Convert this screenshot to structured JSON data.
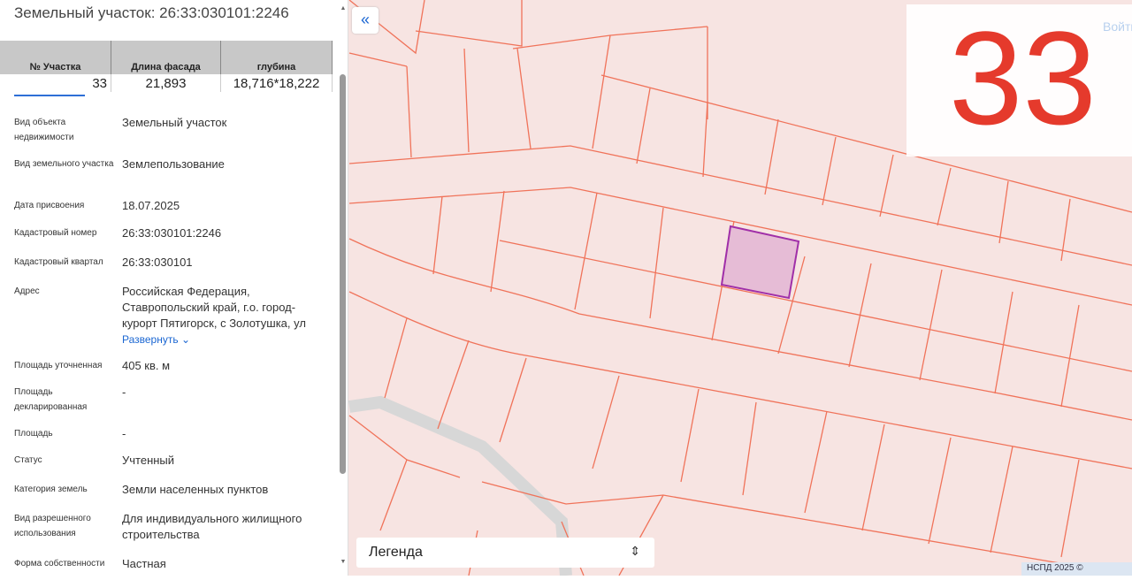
{
  "panel": {
    "title": "Земельный участок: 26:33:030101:2246",
    "overlay_table": {
      "headers": [
        "№ Участка",
        "Длина фасада",
        "глубина"
      ],
      "values": [
        "33",
        "21,893",
        "18,716*18,222"
      ]
    },
    "rows": [
      {
        "k": "Вид объекта недвижимости",
        "v": "Земельный участок"
      },
      {
        "k": "Вид земельного участка",
        "v": "Землепользование"
      },
      {
        "k": "Дата присвоения",
        "v": "18.07.2025"
      },
      {
        "k": "Кадастровый номер",
        "v": "26:33:030101:2246"
      },
      {
        "k": "Кадастровый квартал",
        "v": "26:33:030101"
      },
      {
        "k": "Адрес",
        "v": "Российская Федерация, Ставропольский край, г.о. город-курорт Пятигорск, с Золотушка, ул"
      },
      {
        "k": "Площадь уточненная",
        "v": "405 кв. м"
      },
      {
        "k": "Площадь декларированная",
        "v": "-"
      },
      {
        "k": "Площадь",
        "v": "-"
      },
      {
        "k": "Статус",
        "v": "Учтенный"
      },
      {
        "k": "Категория земель",
        "v": "Земли населенных пунктов"
      },
      {
        "k": "Вид разрешенного использования",
        "v": "Для индивидуального жилищного строительства"
      },
      {
        "k": "Форма собственности",
        "v": "Частная"
      }
    ],
    "expand": "Развернуть"
  },
  "map": {
    "collapse": "«",
    "plot_number": "33",
    "login": "Войти",
    "legend": "Легенда",
    "attribution": "НСПД 2025 ©",
    "colors": {
      "parcel_line": "#f0735a",
      "selected": "#a02fa8"
    }
  }
}
